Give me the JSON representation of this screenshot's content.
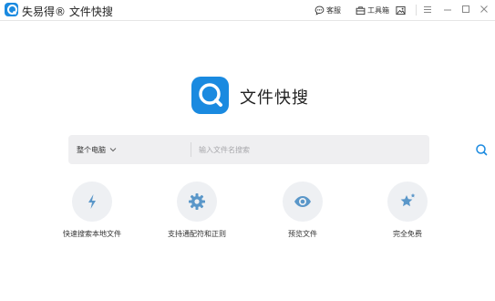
{
  "titlebar": {
    "app_name": "失易得® 文件快搜",
    "actions": [
      {
        "label": "客服",
        "icon": "chat-icon"
      },
      {
        "label": "工具箱",
        "icon": "toolbox-icon"
      },
      {
        "label": "",
        "icon": "image-icon"
      }
    ],
    "window_controls": [
      "menu-icon",
      "minimize-icon",
      "maximize-icon",
      "close-icon"
    ]
  },
  "hero": {
    "title": "文件快搜",
    "logo_color": "#1a8ae0"
  },
  "search": {
    "scope_label": "整个电脑",
    "placeholder": "输入文件名搜索",
    "value": ""
  },
  "features": [
    {
      "icon": "lightning-icon",
      "label": "快速搜索本地文件"
    },
    {
      "icon": "gear-icon",
      "label": "支持通配符和正则"
    },
    {
      "icon": "eye-icon",
      "label": "预览文件"
    },
    {
      "icon": "star-icon",
      "label": "完全免费"
    }
  ],
  "colors": {
    "accent": "#1a8ae0",
    "feature_icon": "#5a97c9",
    "search_bg": "#efeff1"
  }
}
